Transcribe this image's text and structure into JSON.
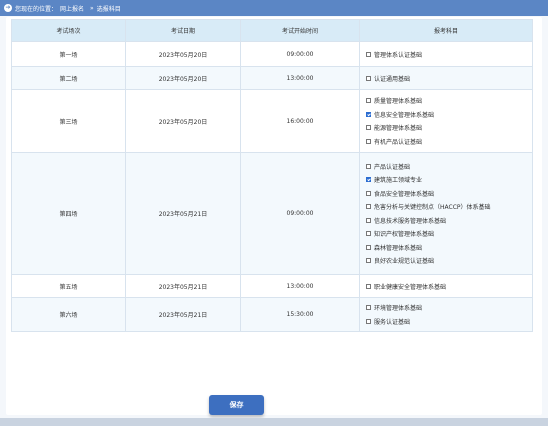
{
  "breadcrumb": {
    "prefix": "您现在的位置：",
    "path": [
      "网上报名",
      "选报科目"
    ],
    "separator": "»"
  },
  "table": {
    "headers": [
      "考试场次",
      "考试日期",
      "考试开始时间",
      "报考科目"
    ],
    "rows": [
      {
        "session": "第一场",
        "date": "2023年05月20日",
        "time": "09:00:00",
        "subjects": [
          {
            "label": "管理体系认证基础",
            "checked": false
          }
        ]
      },
      {
        "session": "第二场",
        "date": "2023年05月20日",
        "time": "13:00:00",
        "subjects": [
          {
            "label": "认证通用基础",
            "checked": false
          }
        ]
      },
      {
        "session": "第三场",
        "date": "2023年05月20日",
        "time": "16:00:00",
        "subjects": [
          {
            "label": "质量管理体系基础",
            "checked": false
          },
          {
            "label": "信息安全管理体系基础",
            "checked": true
          },
          {
            "label": "能源管理体系基础",
            "checked": false
          },
          {
            "label": "有机产品认证基础",
            "checked": false
          }
        ]
      },
      {
        "session": "第四场",
        "date": "2023年05月21日",
        "time": "09:00:00",
        "subjects": [
          {
            "label": "产品认证基础",
            "checked": false
          },
          {
            "label": "建筑施工领域专业",
            "checked": true
          },
          {
            "label": "食品安全管理体系基础",
            "checked": false
          },
          {
            "label": "危害分析与关键控制点（HACCP）体系基础",
            "checked": false
          },
          {
            "label": "信息技术服务管理体系基础",
            "checked": false
          },
          {
            "label": "知识产权管理体系基础",
            "checked": false
          },
          {
            "label": "森林管理体系基础",
            "checked": false
          },
          {
            "label": "良好农业规范认证基础",
            "checked": false
          }
        ]
      },
      {
        "session": "第五场",
        "date": "2023年05月21日",
        "time": "13:00:00",
        "subjects": [
          {
            "label": "职业健康安全管理体系基础",
            "checked": false
          }
        ]
      },
      {
        "session": "第六场",
        "date": "2023年05月21日",
        "time": "15:30:00",
        "subjects": [
          {
            "label": "环境管理体系基础",
            "checked": false
          },
          {
            "label": "服务认证基础",
            "checked": false
          }
        ]
      }
    ]
  },
  "save_label": "保存",
  "colors": {
    "header_bar": "#5b86c5",
    "table_header": "#d8ebf7",
    "button": "#3d6fc0",
    "checkbox_checked": "#2b6cd0"
  }
}
